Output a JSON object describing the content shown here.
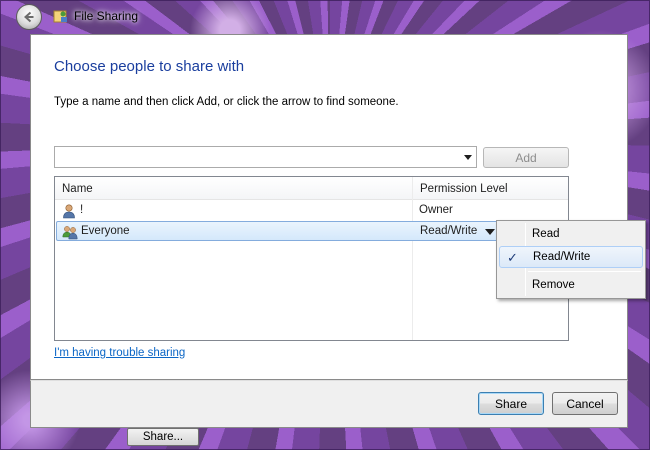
{
  "window": {
    "title": "File Sharing"
  },
  "dialog": {
    "heading": "Choose people to share with",
    "instruction": "Type a name and then click Add, or click the arrow to find someone.",
    "name_input": {
      "value": "",
      "placeholder": ""
    },
    "add_label": "Add",
    "list": {
      "headers": {
        "name": "Name",
        "permission": "Permission Level"
      },
      "rows": [
        {
          "name": "!",
          "permission": "Owner",
          "icon": "user-icon"
        },
        {
          "name": "Everyone",
          "permission": "Read/Write",
          "icon": "group-icon"
        }
      ]
    },
    "trouble_link": "I'm having trouble sharing",
    "share_label": "Share",
    "cancel_label": "Cancel"
  },
  "background": {
    "share_label": "Share..."
  },
  "permission_menu": {
    "items": [
      {
        "label": "Read",
        "checked": false
      },
      {
        "label": "Read/Write",
        "checked": true
      },
      {
        "label": "Remove",
        "checked": false
      }
    ],
    "check_glyph": "✓"
  },
  "colors": {
    "heading": "#1a3e9e",
    "link": "#0b66c6",
    "selection_border": "#84acdd"
  }
}
